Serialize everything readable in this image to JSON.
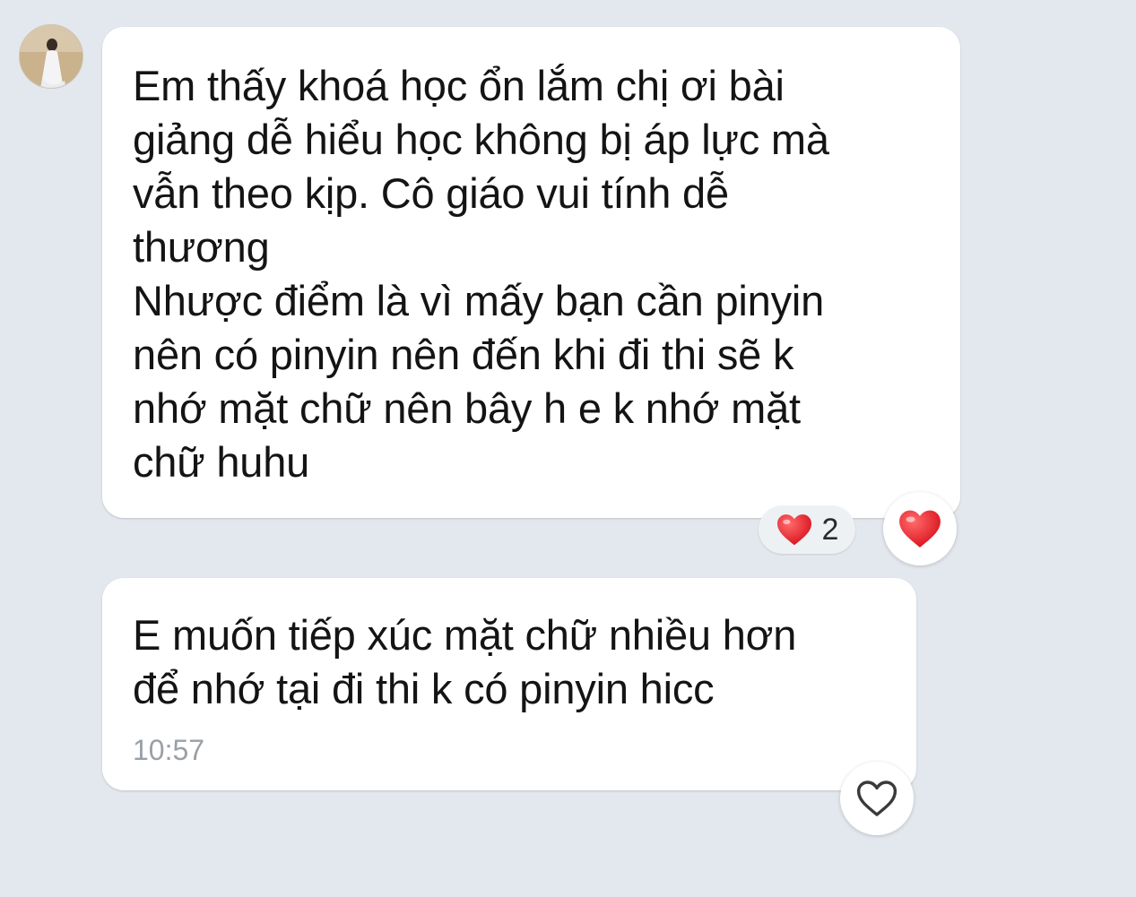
{
  "conversation": {
    "messages": [
      {
        "text": "Em thấy khoá học ổn lắm chị ơi bài\ngiảng dễ hiểu học không bị áp lực mà\nvẫn theo kịp. Cô giáo vui tính dễ\nthương\nNhược điểm là vì mấy bạn cần pinyin\nnên có pinyin nên đến khi đi thi sẽ k\nnhớ mặt chữ nên bây h e k nhớ mặt\nchữ huhu",
        "reaction": {
          "icon": "heart-icon",
          "count": "2",
          "color": "#e8202a"
        },
        "react_button": {
          "icon": "heart-filled-icon",
          "active": true
        }
      },
      {
        "text": "E muốn tiếp xúc mặt chữ nhiều hơn\nđể nhớ tại đi thi k có pinyin hicc",
        "timestamp": "10:57",
        "react_button": {
          "icon": "heart-outline-icon",
          "active": false
        }
      }
    ]
  },
  "theme": {
    "background": "#e3e8ee",
    "bubble": "#ffffff",
    "text": "#141414",
    "timestamp": "#9aa0a6",
    "heart": "#e8202a"
  }
}
